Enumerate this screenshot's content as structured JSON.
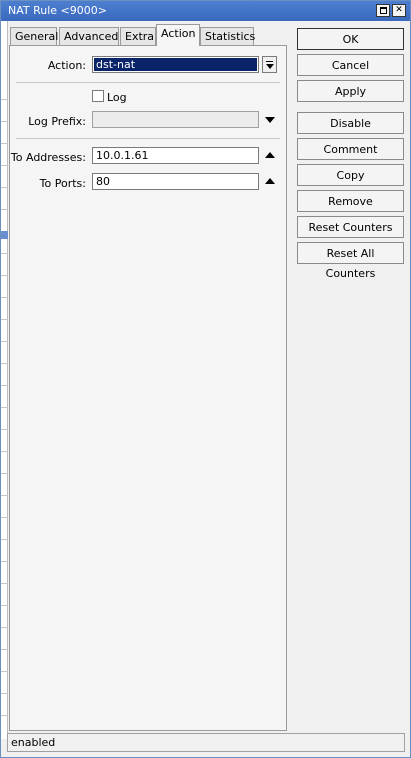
{
  "window": {
    "title": "NAT Rule <9000>"
  },
  "tabs": [
    {
      "label": "General"
    },
    {
      "label": "Advanced"
    },
    {
      "label": "Extra"
    },
    {
      "label": "Action"
    },
    {
      "label": "Statistics"
    }
  ],
  "active_tab": "Action",
  "form": {
    "action_label": "Action:",
    "action_value": "dst-nat",
    "log_label": "Log",
    "log_checked": false,
    "log_prefix_label": "Log Prefix:",
    "log_prefix_value": "",
    "to_addresses_label": "To Addresses:",
    "to_addresses_value": "10.0.1.61",
    "to_ports_label": "To Ports:",
    "to_ports_value": "80"
  },
  "buttons": {
    "ok": "OK",
    "cancel": "Cancel",
    "apply": "Apply",
    "disable": "Disable",
    "comment": "Comment",
    "copy": "Copy",
    "remove": "Remove",
    "reset_counters": "Reset Counters",
    "reset_all_counters": "Reset All Counters"
  },
  "status": {
    "text": "enabled"
  },
  "icons": {
    "maximize": "maximize-icon",
    "close": "close-icon",
    "dropdown": "dropdown-arrow-icon",
    "expand": "expand-up-icon",
    "collapse": "collapse-down-icon"
  },
  "colors": {
    "titlebar": "#3a69bd",
    "selection": "#0a246a"
  }
}
